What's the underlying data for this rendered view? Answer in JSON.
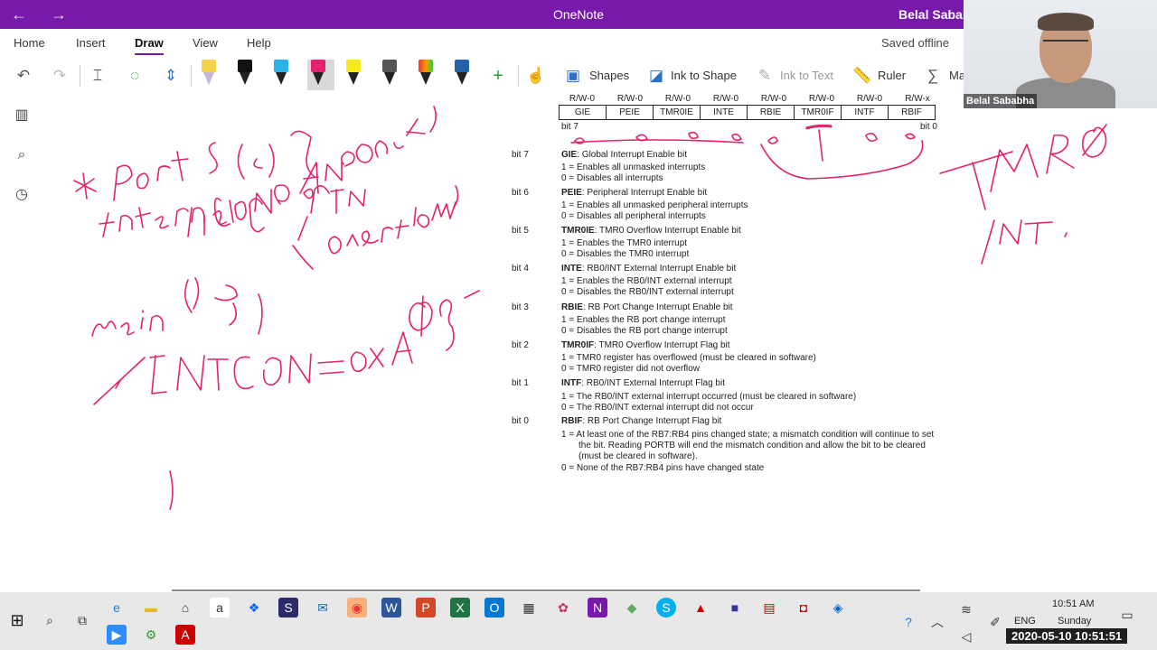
{
  "titlebar": {
    "back": "←",
    "forward": "→",
    "title": "OneNote",
    "user": "Belal Sababh"
  },
  "ribbon": {
    "tabs": [
      "Home",
      "Insert",
      "Draw",
      "View",
      "Help"
    ],
    "status": "Saved offline"
  },
  "toolbar": {
    "shapes": "Shapes",
    "ink_to_shape": "Ink to Shape",
    "ink_to_text": "Ink to Text",
    "ruler": "Ruler",
    "math": "Ma"
  },
  "webcam": {
    "name": "Belal Sababha"
  },
  "register": {
    "rw": [
      "R/W-0",
      "R/W-0",
      "R/W-0",
      "R/W-0",
      "R/W-0",
      "R/W-0",
      "R/W-0",
      "R/W-x"
    ],
    "bits": [
      "GIE",
      "PEIE",
      "TMR0IE",
      "INTE",
      "RBIE",
      "TMR0IF",
      "INTF",
      "RBIF"
    ],
    "bit7_label": "bit 7",
    "bit0_label": "bit 0"
  },
  "descriptions": [
    {
      "bit": "bit 7",
      "name": "GIE",
      "title": ": Global Interrupt Enable bit",
      "opts": [
        "1 = Enables all unmasked interrupts",
        "0 = Disables all interrupts"
      ]
    },
    {
      "bit": "bit 6",
      "name": "PEIE",
      "title": ": Peripheral Interrupt Enable bit",
      "opts": [
        "1 = Enables all unmasked peripheral interrupts",
        "0 = Disables all peripheral interrupts"
      ]
    },
    {
      "bit": "bit 5",
      "name": "TMR0IE",
      "title": ": TMR0 Overflow Interrupt Enable bit",
      "opts": [
        "1 = Enables the TMR0 interrupt",
        "0 = Disables the TMR0 interrupt"
      ]
    },
    {
      "bit": "bit 4",
      "name": "INTE",
      "title": ": RB0/INT External Interrupt Enable bit",
      "opts": [
        "1 = Enables the RB0/INT external interrupt",
        "0 = Disables the RB0/INT external interrupt"
      ]
    },
    {
      "bit": "bit 3",
      "name": "RBIE",
      "title": ": RB Port Change Interrupt Enable bit",
      "opts": [
        "1 = Enables the RB port change interrupt",
        "0 = Disables the RB port change interrupt"
      ]
    },
    {
      "bit": "bit 2",
      "name": "TMR0IF",
      "title": ": TMR0 Overflow Interrupt Flag bit",
      "opts": [
        "1 = TMR0 register has overflowed (must be cleared in software)",
        "0 = TMR0 register did not overflow"
      ]
    },
    {
      "bit": "bit 1",
      "name": "INTF",
      "title": ": RB0/INT External Interrupt Flag bit",
      "opts": [
        "1 = The RB0/INT external interrupt occurred (must be cleared in software)",
        "0 = The RB0/INT external interrupt did not occur"
      ]
    },
    {
      "bit": "bit 0",
      "name": "RBIF",
      "title": ": RB Port Change Interrupt Flag bit",
      "opts": [
        "1 = At least one of the RB7:RB4 pins changed state; a mismatch condition will continue to set",
        "the bit. Reading PORTB will end the mismatch condition and allow the bit to be cleared",
        "(must be cleared in software).",
        "0 = None of the RB7:RB4 pins have changed state"
      ]
    }
  ],
  "clock": {
    "time": "10:51 AM",
    "day": "Sunday",
    "lang": "ENG",
    "stamp": "2020-05-10 10:51:51"
  },
  "colors": {
    "accent": "#7719aa",
    "ink": "#e5226b"
  }
}
